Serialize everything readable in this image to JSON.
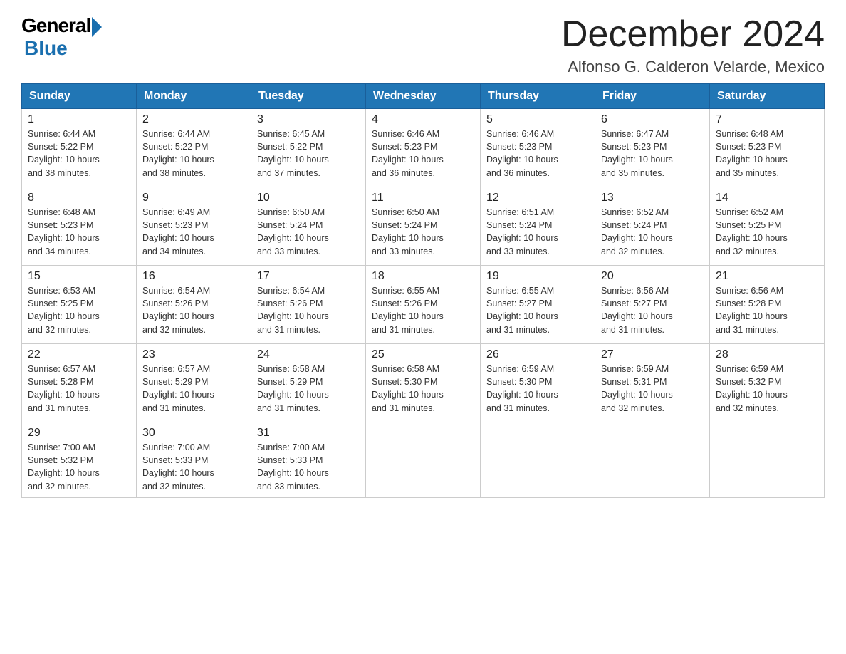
{
  "header": {
    "logo_general": "General",
    "logo_blue": "Blue",
    "month_title": "December 2024",
    "location": "Alfonso G. Calderon Velarde, Mexico"
  },
  "weekdays": [
    "Sunday",
    "Monday",
    "Tuesday",
    "Wednesday",
    "Thursday",
    "Friday",
    "Saturday"
  ],
  "weeks": [
    [
      {
        "day": "1",
        "sunrise": "6:44 AM",
        "sunset": "5:22 PM",
        "daylight": "10 hours and 38 minutes."
      },
      {
        "day": "2",
        "sunrise": "6:44 AM",
        "sunset": "5:22 PM",
        "daylight": "10 hours and 38 minutes."
      },
      {
        "day": "3",
        "sunrise": "6:45 AM",
        "sunset": "5:22 PM",
        "daylight": "10 hours and 37 minutes."
      },
      {
        "day": "4",
        "sunrise": "6:46 AM",
        "sunset": "5:23 PM",
        "daylight": "10 hours and 36 minutes."
      },
      {
        "day": "5",
        "sunrise": "6:46 AM",
        "sunset": "5:23 PM",
        "daylight": "10 hours and 36 minutes."
      },
      {
        "day": "6",
        "sunrise": "6:47 AM",
        "sunset": "5:23 PM",
        "daylight": "10 hours and 35 minutes."
      },
      {
        "day": "7",
        "sunrise": "6:48 AM",
        "sunset": "5:23 PM",
        "daylight": "10 hours and 35 minutes."
      }
    ],
    [
      {
        "day": "8",
        "sunrise": "6:48 AM",
        "sunset": "5:23 PM",
        "daylight": "10 hours and 34 minutes."
      },
      {
        "day": "9",
        "sunrise": "6:49 AM",
        "sunset": "5:23 PM",
        "daylight": "10 hours and 34 minutes."
      },
      {
        "day": "10",
        "sunrise": "6:50 AM",
        "sunset": "5:24 PM",
        "daylight": "10 hours and 33 minutes."
      },
      {
        "day": "11",
        "sunrise": "6:50 AM",
        "sunset": "5:24 PM",
        "daylight": "10 hours and 33 minutes."
      },
      {
        "day": "12",
        "sunrise": "6:51 AM",
        "sunset": "5:24 PM",
        "daylight": "10 hours and 33 minutes."
      },
      {
        "day": "13",
        "sunrise": "6:52 AM",
        "sunset": "5:24 PM",
        "daylight": "10 hours and 32 minutes."
      },
      {
        "day": "14",
        "sunrise": "6:52 AM",
        "sunset": "5:25 PM",
        "daylight": "10 hours and 32 minutes."
      }
    ],
    [
      {
        "day": "15",
        "sunrise": "6:53 AM",
        "sunset": "5:25 PM",
        "daylight": "10 hours and 32 minutes."
      },
      {
        "day": "16",
        "sunrise": "6:54 AM",
        "sunset": "5:26 PM",
        "daylight": "10 hours and 32 minutes."
      },
      {
        "day": "17",
        "sunrise": "6:54 AM",
        "sunset": "5:26 PM",
        "daylight": "10 hours and 31 minutes."
      },
      {
        "day": "18",
        "sunrise": "6:55 AM",
        "sunset": "5:26 PM",
        "daylight": "10 hours and 31 minutes."
      },
      {
        "day": "19",
        "sunrise": "6:55 AM",
        "sunset": "5:27 PM",
        "daylight": "10 hours and 31 minutes."
      },
      {
        "day": "20",
        "sunrise": "6:56 AM",
        "sunset": "5:27 PM",
        "daylight": "10 hours and 31 minutes."
      },
      {
        "day": "21",
        "sunrise": "6:56 AM",
        "sunset": "5:28 PM",
        "daylight": "10 hours and 31 minutes."
      }
    ],
    [
      {
        "day": "22",
        "sunrise": "6:57 AM",
        "sunset": "5:28 PM",
        "daylight": "10 hours and 31 minutes."
      },
      {
        "day": "23",
        "sunrise": "6:57 AM",
        "sunset": "5:29 PM",
        "daylight": "10 hours and 31 minutes."
      },
      {
        "day": "24",
        "sunrise": "6:58 AM",
        "sunset": "5:29 PM",
        "daylight": "10 hours and 31 minutes."
      },
      {
        "day": "25",
        "sunrise": "6:58 AM",
        "sunset": "5:30 PM",
        "daylight": "10 hours and 31 minutes."
      },
      {
        "day": "26",
        "sunrise": "6:59 AM",
        "sunset": "5:30 PM",
        "daylight": "10 hours and 31 minutes."
      },
      {
        "day": "27",
        "sunrise": "6:59 AM",
        "sunset": "5:31 PM",
        "daylight": "10 hours and 32 minutes."
      },
      {
        "day": "28",
        "sunrise": "6:59 AM",
        "sunset": "5:32 PM",
        "daylight": "10 hours and 32 minutes."
      }
    ],
    [
      {
        "day": "29",
        "sunrise": "7:00 AM",
        "sunset": "5:32 PM",
        "daylight": "10 hours and 32 minutes."
      },
      {
        "day": "30",
        "sunrise": "7:00 AM",
        "sunset": "5:33 PM",
        "daylight": "10 hours and 32 minutes."
      },
      {
        "day": "31",
        "sunrise": "7:00 AM",
        "sunset": "5:33 PM",
        "daylight": "10 hours and 33 minutes."
      },
      null,
      null,
      null,
      null
    ]
  ]
}
